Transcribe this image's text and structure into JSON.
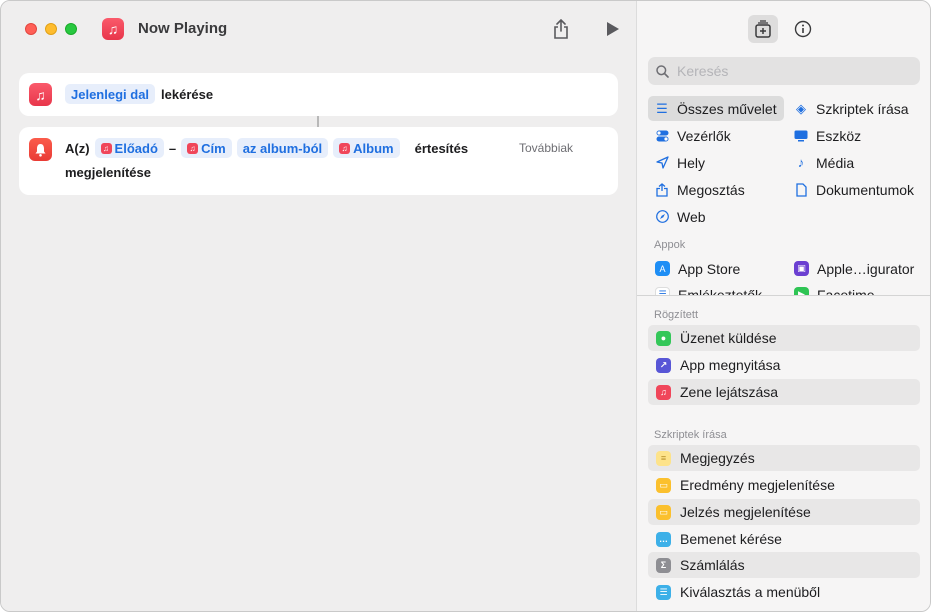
{
  "window": {
    "title": "Now Playing",
    "app_icon": "music-note-icon"
  },
  "toolbar": {
    "share_icon": "share-icon",
    "run_icon": "play-icon"
  },
  "editor": {
    "action1": {
      "variable": "Jelenlegi dal",
      "text": "lekérése"
    },
    "action2": {
      "prefix": "A(z)",
      "var_artist": "Előadó",
      "dash": "–",
      "var_title": "Cím",
      "from_album": "az album-ból",
      "var_album": "Album",
      "text_notify": "értesítés",
      "text_show": "megjelenítése",
      "more": "Továbbiak"
    }
  },
  "library": {
    "search": {
      "placeholder": "Keresés",
      "value": ""
    },
    "categories": [
      {
        "label": "Összes művelet",
        "icon": "list-icon",
        "selected": true
      },
      {
        "label": "Szkriptek írása",
        "icon": "scripting-icon"
      },
      {
        "label": "Vezérlők",
        "icon": "toggle-icon"
      },
      {
        "label": "Eszköz",
        "icon": "display-icon"
      },
      {
        "label": "Hely",
        "icon": "location-arrow-icon"
      },
      {
        "label": "Média",
        "icon": "music-note-icon"
      },
      {
        "label": "Megosztás",
        "icon": "share-icon"
      },
      {
        "label": "Dokumentumok",
        "icon": "document-icon"
      },
      {
        "label": "Web",
        "icon": "compass-icon"
      }
    ],
    "apps_header": "Appok",
    "apps": [
      {
        "label": "App Store",
        "color": "#1e8ef5"
      },
      {
        "label": "Apple…igurator",
        "color": "#6b3fd1"
      },
      {
        "label": "Emlékeztetők",
        "color": "#ffffff"
      },
      {
        "label": "Facetime",
        "color": "#2fc454"
      }
    ],
    "pinned_header": "Rögzített",
    "pinned": [
      {
        "label": "Üzenet küldése",
        "color": "#34c759",
        "icon": "message-icon",
        "shaded": true
      },
      {
        "label": "App megnyitása",
        "color": "#5856d6",
        "icon": "arrow-up-right-icon",
        "shaded": false
      },
      {
        "label": "Zene lejátszása",
        "color": "#f0465a",
        "icon": "music-note-icon",
        "shaded": true
      }
    ],
    "scripting_header": "Szkriptek írása",
    "scripting": [
      {
        "label": "Megjegyzés",
        "color": "#fde38a",
        "icon": "lines-icon",
        "shaded": true
      },
      {
        "label": "Eredmény megjelenítése",
        "color": "#fbc02d",
        "icon": "result-icon",
        "shaded": false
      },
      {
        "label": "Jelzés megjelenítése",
        "color": "#fbc02d",
        "icon": "alert-icon",
        "shaded": true
      },
      {
        "label": "Bemenet kérése",
        "color": "#3db0e8",
        "icon": "speech-bubble-icon",
        "shaded": false
      },
      {
        "label": "Számlálás",
        "color": "#8e8e93",
        "icon": "sigma-icon",
        "shaded": true
      },
      {
        "label": "Kiválasztás a menüből",
        "color": "#3db0e8",
        "icon": "menu-icon",
        "shaded": false
      }
    ]
  }
}
